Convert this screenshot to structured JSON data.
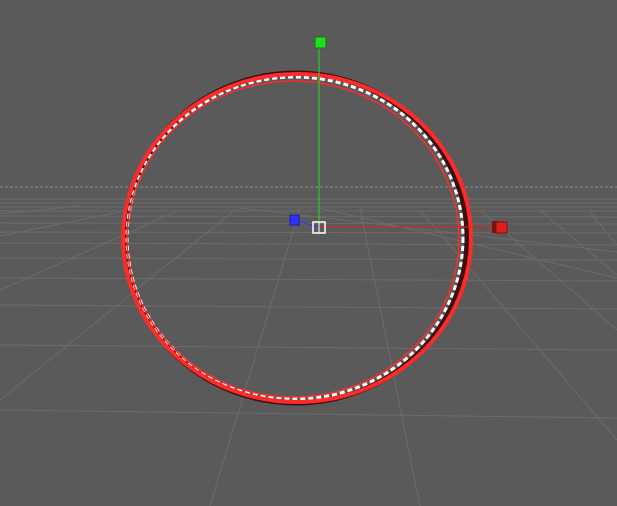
{
  "viewport": {
    "background": "#5a5a5a",
    "grid_color": "#6a6a6a",
    "horizon_color": "#8a8a8a"
  },
  "object": {
    "type": "ring",
    "selected": true,
    "outline_color": "#ff2a2a",
    "inner_color": "#ffffff",
    "shadow_color": "#3a1010"
  },
  "gizmo": {
    "x_axis_color": "#e02020",
    "y_axis_color": "#22dd22",
    "z_axis_color": "#3333ff",
    "center_handle_color": "#ffffff"
  }
}
